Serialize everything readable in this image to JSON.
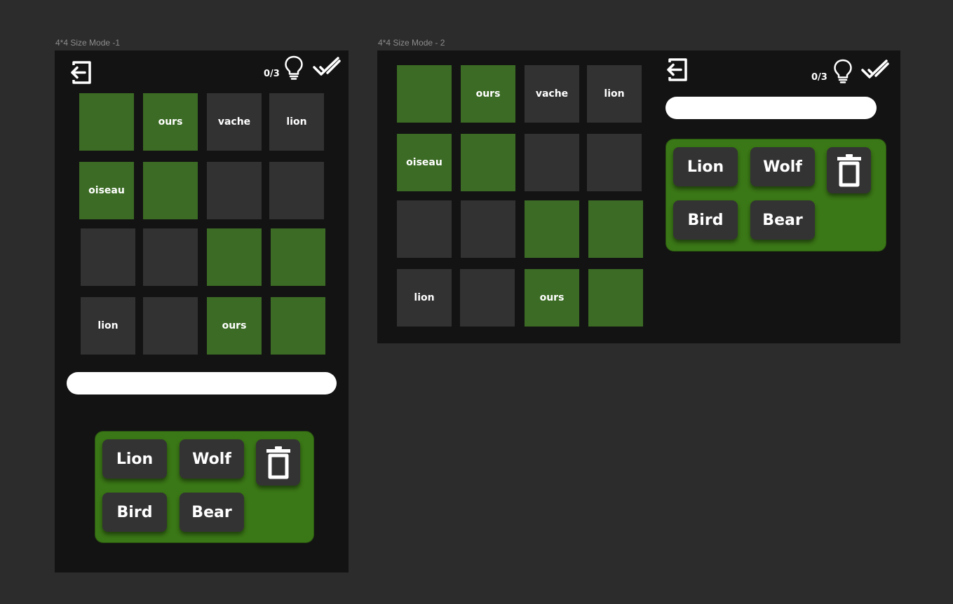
{
  "frames": [
    {
      "label": "4*4 Size Mode -1",
      "hint_counter": "0/3",
      "grid": [
        {
          "text": "",
          "color": "green"
        },
        {
          "text": "ours",
          "color": "green"
        },
        {
          "text": "vache",
          "color": "dark"
        },
        {
          "text": "lion",
          "color": "dark"
        },
        {
          "text": "oiseau",
          "color": "green"
        },
        {
          "text": "",
          "color": "green"
        },
        {
          "text": "",
          "color": "dark"
        },
        {
          "text": "",
          "color": "dark"
        },
        {
          "text": "",
          "color": "dark"
        },
        {
          "text": "",
          "color": "dark"
        },
        {
          "text": "",
          "color": "green"
        },
        {
          "text": "",
          "color": "green"
        },
        {
          "text": "lion",
          "color": "dark"
        },
        {
          "text": "",
          "color": "dark"
        },
        {
          "text": "ours",
          "color": "green"
        },
        {
          "text": "",
          "color": "green"
        }
      ],
      "answer_value": "",
      "chips": [
        "Lion",
        "Wolf",
        "Bird",
        "Bear"
      ]
    },
    {
      "label": "4*4 Size Mode - 2",
      "hint_counter": "0/3",
      "grid": [
        {
          "text": "",
          "color": "green"
        },
        {
          "text": "ours",
          "color": "green"
        },
        {
          "text": "vache",
          "color": "dark"
        },
        {
          "text": "lion",
          "color": "dark"
        },
        {
          "text": "oiseau",
          "color": "green"
        },
        {
          "text": "",
          "color": "green"
        },
        {
          "text": "",
          "color": "dark"
        },
        {
          "text": "",
          "color": "dark"
        },
        {
          "text": "",
          "color": "dark"
        },
        {
          "text": "",
          "color": "dark"
        },
        {
          "text": "",
          "color": "green"
        },
        {
          "text": "",
          "color": "green"
        },
        {
          "text": "lion",
          "color": "dark"
        },
        {
          "text": "",
          "color": "dark"
        },
        {
          "text": "ours",
          "color": "green"
        },
        {
          "text": "",
          "color": "green"
        }
      ],
      "answer_value": "",
      "chips": [
        "Lion",
        "Wolf",
        "Bird",
        "Bear"
      ]
    }
  ],
  "icons": {
    "exit": "exit-arrow-icon",
    "hint": "lightbulb-icon",
    "validate": "double-check-icon",
    "delete": "trash-icon"
  },
  "colors": {
    "background": "#2c2c2c",
    "frame": "#131313",
    "cell_dark": "#323232",
    "cell_green": "#3b6b24",
    "panel_green": "#3a7716",
    "chip": "#333333",
    "input": "#ffffff"
  }
}
